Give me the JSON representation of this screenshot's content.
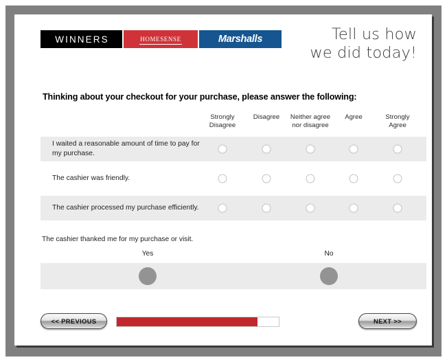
{
  "header": {
    "logos": [
      {
        "name": "winners",
        "text": "WINNERS",
        "bg": "#000000"
      },
      {
        "name": "homesense",
        "text": "HomeSense",
        "bg": "#cf3339"
      },
      {
        "name": "marshalls",
        "text": "Marshalls",
        "bg": "#16558f"
      }
    ],
    "tagline": "Tell us how\nwe did today!"
  },
  "survey": {
    "prompt": "Thinking about your checkout for your purchase, please answer the following:",
    "scale_headers": [
      "Strongly\nDisagree",
      "Disagree",
      "Neither agree\nnor disagree",
      "Agree",
      "Strongly\nAgree"
    ],
    "rows": [
      {
        "label": "I waited a reasonable amount of time to pay for my purchase.",
        "shaded": true,
        "selected": null
      },
      {
        "label": "The cashier was friendly.",
        "shaded": false,
        "selected": null
      },
      {
        "label": "The cashier processed my purchase efficiently.",
        "shaded": true,
        "selected": null
      }
    ],
    "yesno": {
      "question": "The cashier thanked me for my purchase or visit.",
      "yes_label": "Yes",
      "no_label": "No",
      "selected": null
    }
  },
  "footer": {
    "previous_label": "<< PREVIOUS",
    "next_label": "NEXT >>",
    "progress_percent": 87,
    "progress_color": "#c1272d"
  }
}
